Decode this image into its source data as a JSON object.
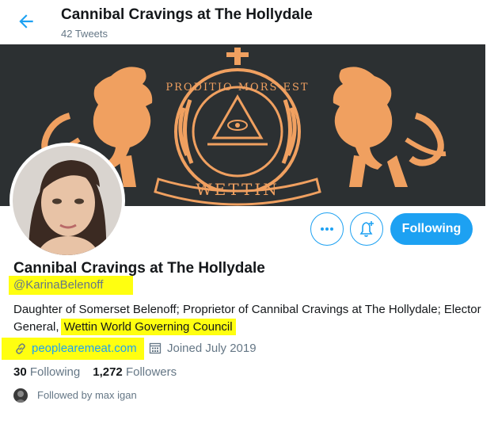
{
  "header": {
    "title": "Cannibal Cravings at The Hollydale",
    "tweet_count": "42 Tweets"
  },
  "banner": {
    "motto": "PRODITIO MORS EST",
    "house": "WETTIN",
    "colors": {
      "background": "#2c3032",
      "emblem": "#f0a060"
    }
  },
  "actions": {
    "more_icon": "more-dots-icon",
    "notify_icon": "bell-plus-icon",
    "follow_label": "Following"
  },
  "profile": {
    "name": "Cannibal Cravings at The Hollydale",
    "handle": "@KarinaBelenoff",
    "bio_text": "Daughter of Somerset Belenoff; Proprietor of Cannibal Cravings at The Hollydale; Elector General,",
    "bio_highlight": "Wettin World Governing Council",
    "website": "peoplearemeat.com",
    "joined": "Joined July 2019",
    "following_count": "30",
    "following_label": "Following",
    "followers_count": "1,272",
    "followers_label": "Followers",
    "followed_by": "Followed by max igan"
  },
  "colors": {
    "accent": "#1da1f2",
    "highlight": "#ffff10",
    "secondary_text": "#657786"
  }
}
